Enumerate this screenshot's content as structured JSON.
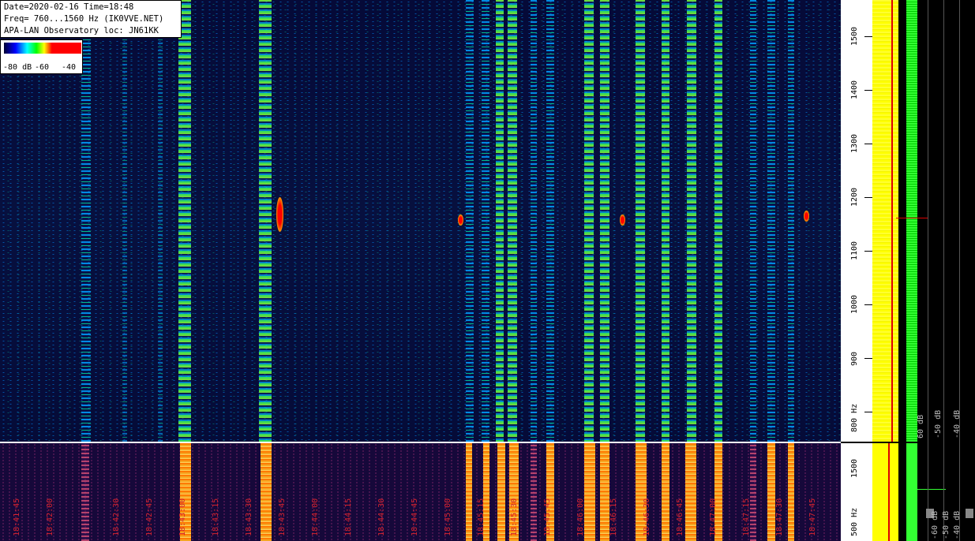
{
  "info": {
    "line1": "Date=2020-02-16 Time=18:48",
    "line2": "Freq= 760...1560 Hz (IK0VVE.NET)",
    "line3": "APA-LAN Observatory loc: JN61KK"
  },
  "colorbar": {
    "label_a": "-80 dB",
    "label_b": "-60",
    "label_c": "-40"
  },
  "freq_axis": {
    "ticks": [
      "1500",
      "1400",
      "1300",
      "1200",
      "1100",
      "1000",
      "900",
      "800 Hz"
    ]
  },
  "bottom_axis": {
    "ticks": [
      "1500",
      "500 Hz"
    ]
  },
  "db_axis": {
    "top": [
      "60 dB",
      "-50 dB",
      "-40 dB"
    ],
    "bottom": [
      "-60 dB",
      "-50 dB",
      "-40 dB"
    ]
  },
  "times": [
    "18:41:45",
    "18:42:00",
    "18:42:30",
    "18:42:45",
    "18:43:00",
    "18:43:15",
    "18:43:30",
    "18:43:45",
    "18:44:00",
    "18:44:15",
    "18:44:30",
    "18:44:45",
    "18:45:00",
    "18:45:15",
    "18:45:30",
    "18:45:45",
    "18:46:00",
    "18:46:15",
    "18:46:30",
    "18:46:45",
    "18:47:00",
    "18:47:15",
    "18:47:30",
    "18:47:45"
  ],
  "colors": {
    "background": "#050a38",
    "spectrum_yellow": "#ffff00",
    "spectrum_green": "#33ff33",
    "marker_red": "#dd0000",
    "time_label": "#d4232f"
  }
}
